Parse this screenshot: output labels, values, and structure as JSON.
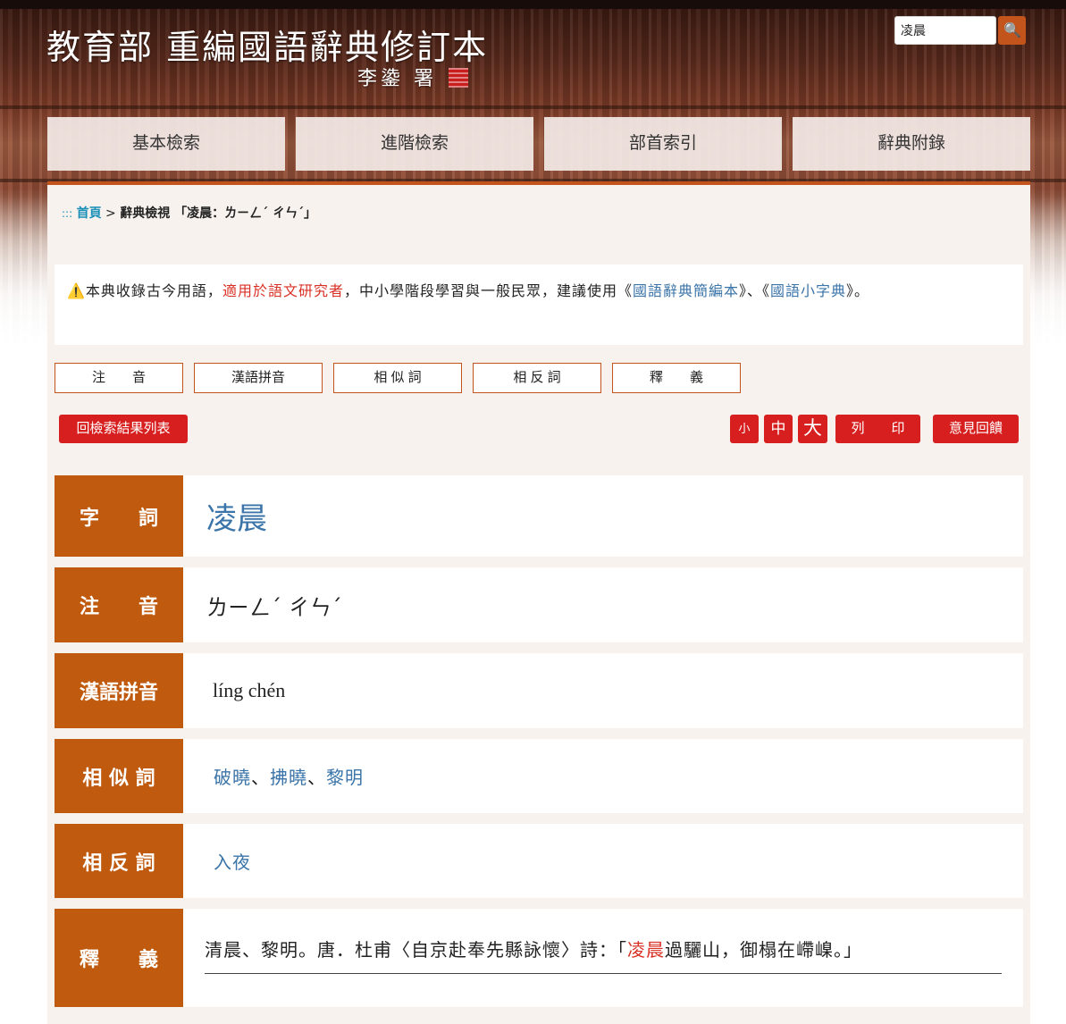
{
  "header": {
    "title": "教育部 重編國語辭典修訂本",
    "subtitle": "李鍌 署"
  },
  "search": {
    "value": "凌晨",
    "button_icon": "magnifier-icon"
  },
  "nav": [
    "基本檢索",
    "進階檢索",
    "部首索引",
    "辭典附錄"
  ],
  "breadcrumb": {
    "sep": ":::",
    "home": "首頁",
    "arrow": ">",
    "current": "辭典檢視 「凌晨：ㄌㄧㄥˊ ㄔㄣˊ」"
  },
  "notice": {
    "icon": "⚠️",
    "t1": "本典收錄古今用語，",
    "red": "適用於語文研究者",
    "t2": "，中小學階段學習與一般民眾，建議使用《",
    "link1": "國語辭典簡編本",
    "t3": "》、《",
    "link2": "國語小字典",
    "t4": "》。"
  },
  "tabs": [
    "注　　音",
    "漢語拼音",
    "相 似 詞",
    "相 反 詞",
    "釋　　義"
  ],
  "actions": {
    "back": "回檢索結果列表",
    "small": "小",
    "medium": "中",
    "large": "大",
    "print": "列　　印",
    "feedback": "意見回饋"
  },
  "entry": {
    "word": {
      "label": "字　　詞",
      "value": "凌晨"
    },
    "zhuyin": {
      "label": "注　　音",
      "value": "ㄌㄧㄥˊ ㄔㄣˊ"
    },
    "pinyin": {
      "label": "漢語拼音",
      "value": "líng chén"
    },
    "synonyms": {
      "label": "相 似 詞",
      "items": [
        "破曉",
        "拂曉",
        "黎明"
      ],
      "sep": "、"
    },
    "antonyms": {
      "label": "相 反 詞",
      "items": [
        "入夜"
      ]
    },
    "definition": {
      "label": "釋　　義",
      "before": "清晨、黎明。唐．杜甫〈自京赴奉先縣詠懷〉詩：「",
      "highlight": "凌晨",
      "after": "過驪山，御榻在嵽嵲。」"
    }
  },
  "colors": {
    "accent": "#c2541c",
    "label_bg": "#bf5a0e",
    "button_red": "#d81f1f",
    "link_blue": "#3b74a8",
    "highlight_red": "#d93025"
  }
}
